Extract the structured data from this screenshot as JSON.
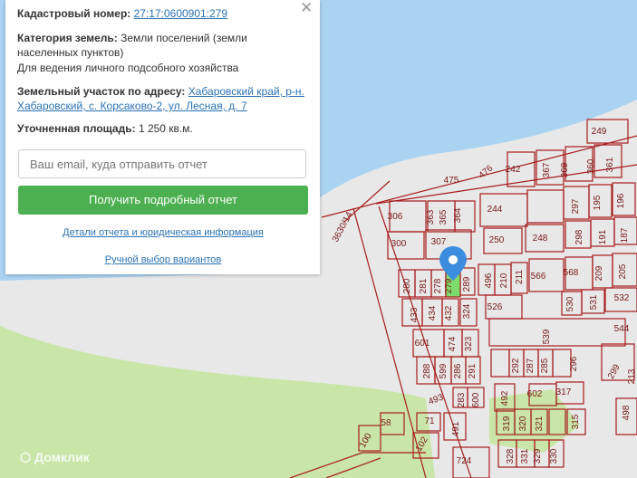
{
  "panel": {
    "cadastral_label": "Кадастровый номер:",
    "cadastral_value": "27:17:0600901:279",
    "category_label": "Категория земель:",
    "category_value": "Земли поселений (земли",
    "category_value2": "населенных пунктов)",
    "usage": "Для ведения личного подсобного хозяйства",
    "address_label": "Земельный участок по адресу:",
    "address_value1": "Хабаровский край, р-н.",
    "address_value2": "Хабаровский, с. Корсаково-2, ул. Лесная, д. 7",
    "area_label": "Уточненная площадь:",
    "area_value": "1 250 кв.м.",
    "email_placeholder": "Ваш email, куда отправить отчет",
    "report_button": "Получить подробный отчет",
    "details_link": "Детали отчета и юридическая информация",
    "manual_link": "Ручной выбор вариантов"
  },
  "map": {
    "logo": "Домклик",
    "road_label": "3630/14",
    "highlighted_parcel": "279",
    "parcels": [
      "249",
      "242",
      "367",
      "369",
      "360",
      "361",
      "475",
      "476",
      "244",
      "297",
      "195",
      "196",
      "306",
      "363",
      "365",
      "364",
      "250",
      "248",
      "298",
      "191",
      "187",
      "300",
      "307",
      "566",
      "568",
      "209",
      "205",
      "280",
      "281",
      "278",
      "289",
      "496",
      "210",
      "211",
      "526",
      "530",
      "531",
      "532",
      "433",
      "434",
      "432",
      "324",
      "539",
      "544",
      "601",
      "474",
      "323",
      "288",
      "599",
      "286",
      "291",
      "292",
      "287",
      "285",
      "296",
      "299",
      "213",
      "493",
      "283",
      "600",
      "492",
      "602",
      "317",
      "58",
      "71",
      "491",
      "319",
      "320",
      "321",
      "315",
      "100",
      "102",
      "724",
      "328",
      "331",
      "329",
      "330",
      "498"
    ]
  },
  "colors": {
    "button": "#4caf50",
    "link": "#2a72b5",
    "parcel_line": "#a81c1c",
    "water": "#aad3f2",
    "highlight": "#7ddc6c",
    "pin": "#3c8dde"
  }
}
